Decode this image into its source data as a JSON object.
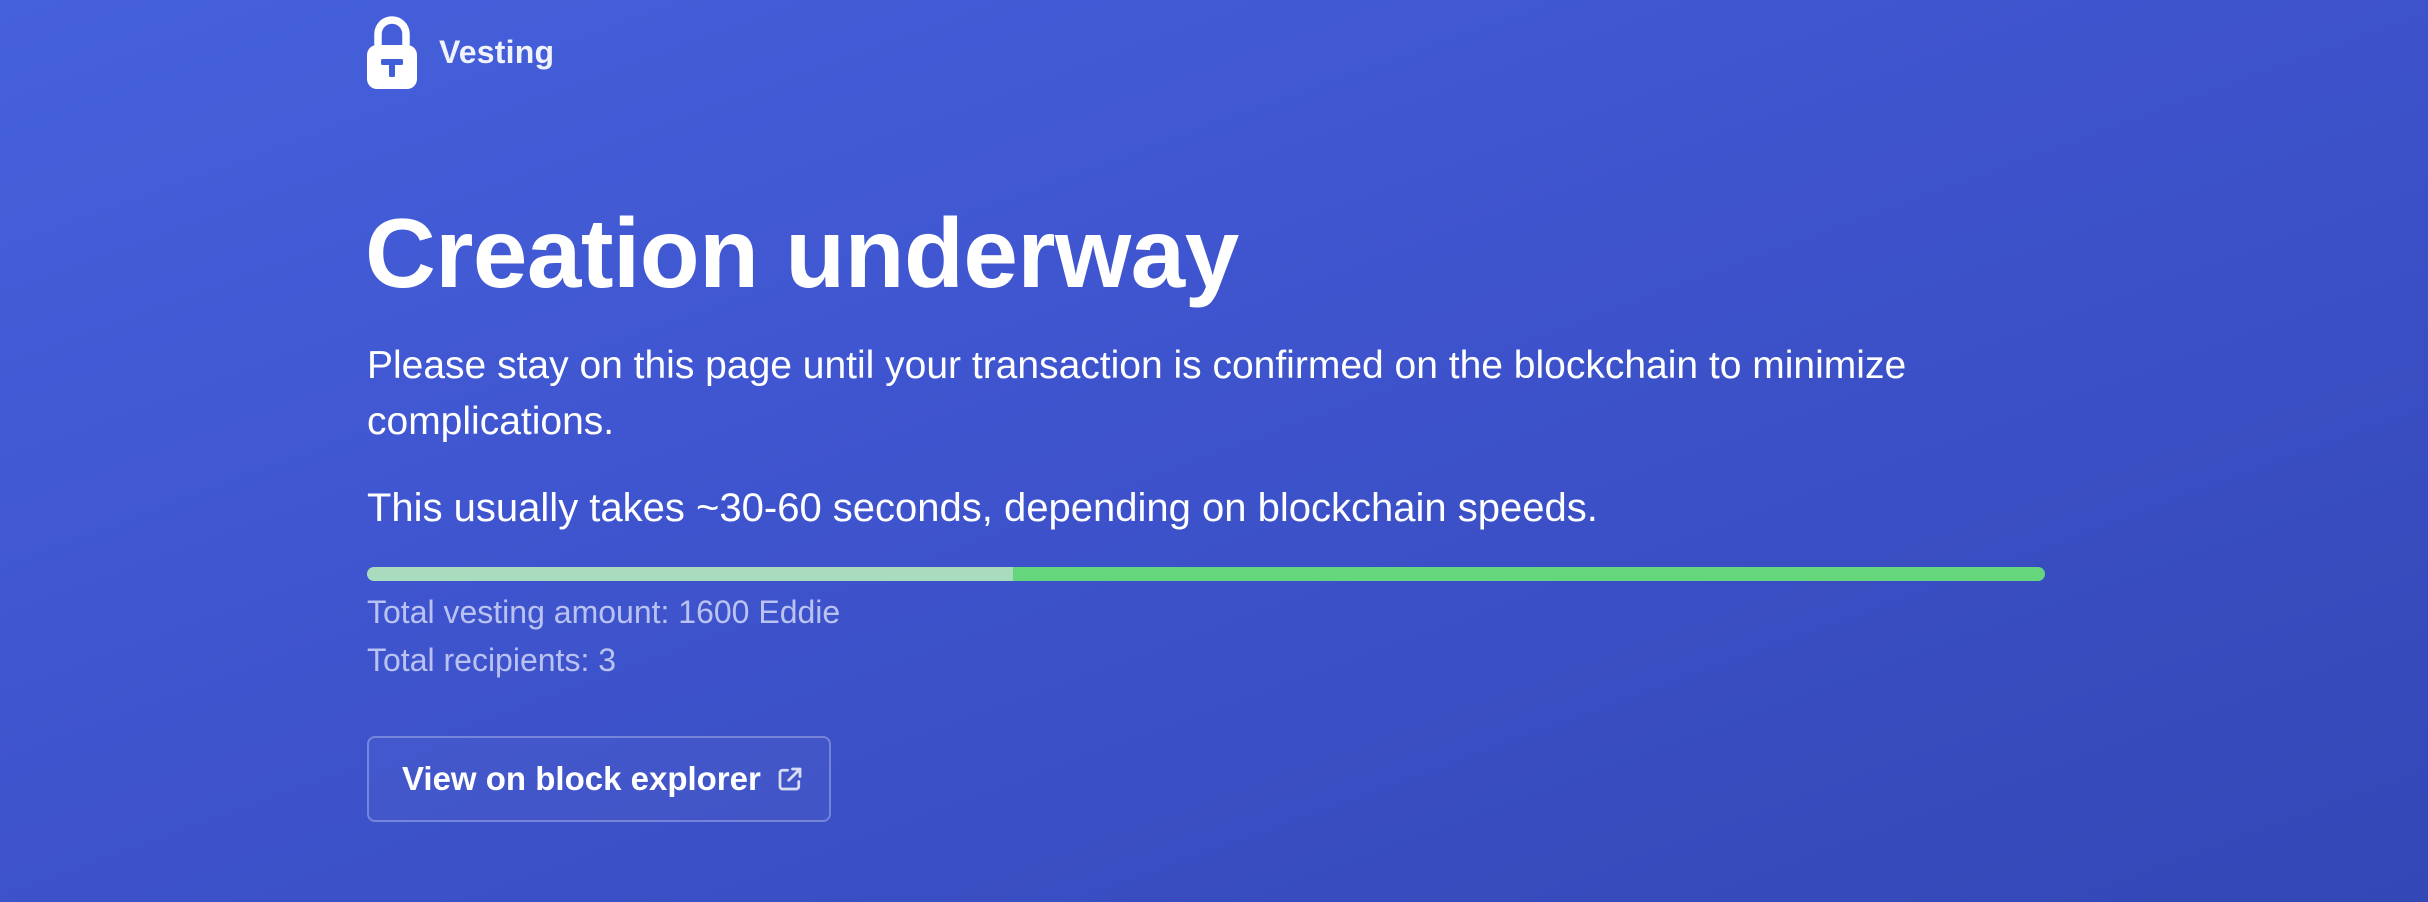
{
  "header": {
    "brand": "Vesting",
    "logo_icon": "lock-icon"
  },
  "main": {
    "title": "Creation underway",
    "description": "Please stay on this page until your transaction is confirmed on the blockchain to minimize complications.",
    "duration_note": "This usually takes ~30-60 seconds, depending on blockchain speeds.",
    "progress_fraction": 0.385,
    "total_vesting": "Total vesting amount: 1600 Eddie",
    "total_recipients": "Total recipients: 3",
    "explorer_button": {
      "label": "View on block explorer",
      "icon": "external-link-icon"
    }
  },
  "colors": {
    "background_start": "#4661dc",
    "background_end": "#3447b6",
    "progress_done": "#a9dcbf",
    "progress_remaining": "#65d67c"
  }
}
